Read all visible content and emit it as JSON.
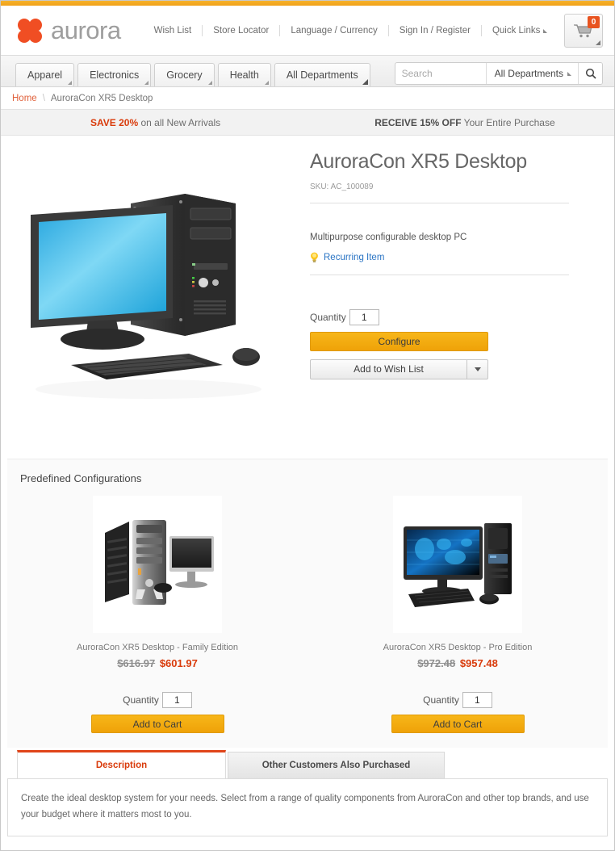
{
  "theme": {
    "accent_orange": "#f5a623",
    "brand_red": "#e8531f",
    "link_blue": "#2a74c4",
    "price_red": "#d93b0b",
    "text_gray": "#6d6d6d"
  },
  "header": {
    "logo_text": "aurora",
    "logo_icon": "clover-icon",
    "util_links": [
      {
        "label": "Wish List"
      },
      {
        "label": "Store Locator"
      },
      {
        "label": "Language / Currency"
      },
      {
        "label": "Sign In / Register"
      },
      {
        "label": "Quick Links"
      }
    ],
    "cart": {
      "icon": "shopping-cart-icon",
      "count": "0"
    }
  },
  "navbar": {
    "tabs": [
      {
        "label": "Apparel"
      },
      {
        "label": "Electronics"
      },
      {
        "label": "Grocery"
      },
      {
        "label": "Health"
      },
      {
        "label": "All Departments"
      }
    ],
    "search": {
      "placeholder": "Search",
      "value": "",
      "department": "All Departments",
      "button_icon": "search-icon"
    }
  },
  "breadcrumb": {
    "home": "Home",
    "separator": "\\",
    "current": "AuroraCon XR5 Desktop"
  },
  "promo": {
    "left_highlight": "SAVE 20%",
    "left_rest": " on all New Arrivals",
    "right_highlight": "RECEIVE 15% OFF",
    "right_rest": " Your Entire Purchase"
  },
  "product": {
    "title": "AuroraCon XR5 Desktop",
    "sku": "SKU: AC_100089",
    "description": "Multipurpose configurable desktop PC",
    "recurring_label": "Recurring Item",
    "recurring_icon": "lightbulb-icon",
    "quantity_label": "Quantity",
    "quantity_value": "1",
    "configure_button": "Configure",
    "wishlist_button": "Add to Wish List",
    "wishlist_caret_icon": "chevron-down-icon",
    "image_alt": "desktop-computer-image"
  },
  "configs": {
    "title": "Predefined Configurations",
    "items": [
      {
        "name": "AuroraCon XR5 Desktop - Family Edition",
        "price_old": "$616.97",
        "price_new": "$601.97",
        "quantity_label": "Quantity",
        "quantity_value": "1",
        "add_button": "Add to Cart",
        "image_alt": "family-edition-computer-image"
      },
      {
        "name": "AuroraCon XR5 Desktop - Pro Edition",
        "price_old": "$972.48",
        "price_new": "$957.48",
        "quantity_label": "Quantity",
        "quantity_value": "1",
        "add_button": "Add to Cart",
        "image_alt": "pro-edition-computer-image"
      }
    ]
  },
  "tabs": {
    "items": [
      {
        "label": "Description",
        "active": true
      },
      {
        "label": "Other Customers Also Purchased",
        "active": false
      }
    ],
    "panel_text": "Create the ideal desktop system for your needs. Select from a range of quality components from AuroraCon and other top brands, and use your budget where it matters most to you."
  }
}
